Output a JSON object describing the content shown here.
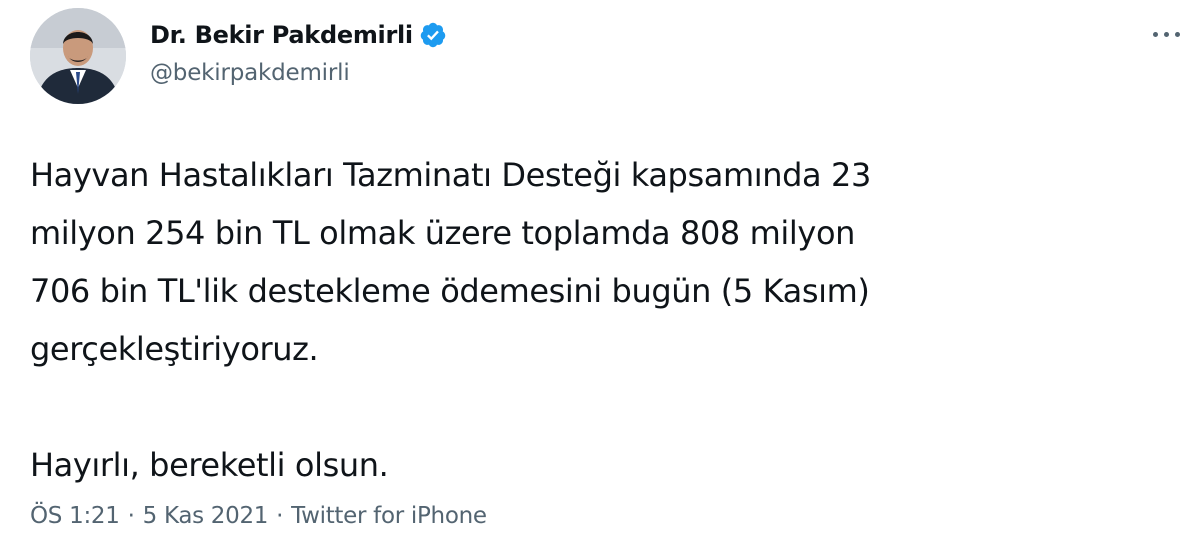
{
  "tweet": {
    "author": {
      "display_name": "Dr. Bekir Pakdemirli",
      "handle": "@bekirpakdemirli",
      "verified": true,
      "avatar_icon": "profile-photo"
    },
    "more_icon": "ellipsis-icon",
    "text_lines": [
      "Hayvan Hastalıkları Tazminatı Desteği kapsamında 23",
      "milyon 254 bin TL olmak üzere toplamda 808 milyon",
      "706 bin TL'lik destekleme ödemesini bugün (5 Kasım)",
      "gerçekleştiriyoruz.",
      "Hayırlı, bereketli olsun."
    ],
    "meta": {
      "time": "ÖS 1:21",
      "separator": "·",
      "date": "5 Kas 2021",
      "source": "Twitter for iPhone"
    },
    "colors": {
      "text": "#0f1419",
      "secondary": "#536471",
      "verified_blue": "#1d9bf0"
    }
  }
}
